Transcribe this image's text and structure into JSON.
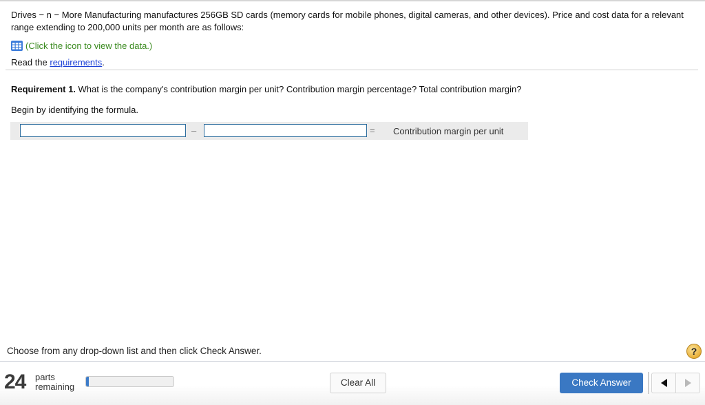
{
  "problem": {
    "intro": "Drives − n − More Manufacturing manufactures 256GB SD cards (memory cards for mobile phones, digital cameras, and other devices). Price and cost data for a relevant range extending to 200,000 units per month are as follows:",
    "data_link_icon": "table-grid-icon",
    "data_link_text": "(Click the icon to view the data.)",
    "read_prefix": "Read the ",
    "requirements_link": "requirements",
    "read_suffix": "."
  },
  "requirement": {
    "label": "Requirement 1.",
    "question": " What is the company's contribution margin per unit? Contribution margin percentage? Total contribution margin?",
    "begin_text": "Begin by identifying the formula."
  },
  "formula": {
    "input1_value": "",
    "operator1": "–",
    "input2_value": "",
    "operator2": "=",
    "result_label": "Contribution margin per unit"
  },
  "instruction": "Choose from any drop-down list and then click Check Answer.",
  "help": {
    "icon": "question-icon",
    "label": "?"
  },
  "footer": {
    "parts_count": "24",
    "parts_label_line1": "parts",
    "parts_label_line2": "remaining",
    "progress_fraction": 0.03,
    "clear_all_label": "Clear All",
    "check_answer_label": "Check Answer",
    "prev_icon": "triangle-left-icon",
    "next_icon": "triangle-right-icon"
  },
  "colors": {
    "accent": "#3a78c3",
    "link": "#1a3fd6",
    "data_link": "#3a8a1f",
    "input_border": "#2e6e9e",
    "help_badge": "#e9b13a"
  }
}
